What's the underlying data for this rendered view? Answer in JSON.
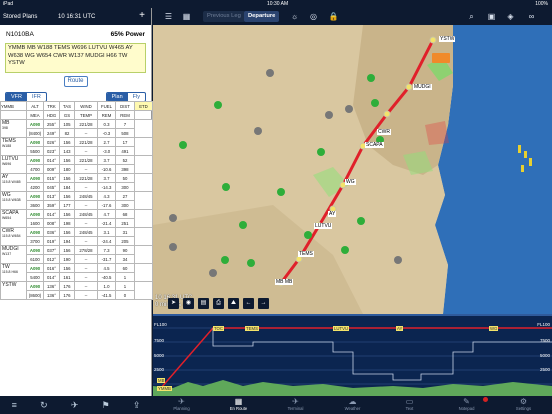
{
  "status": {
    "device": "iPad",
    "time": "10:30 AM",
    "battery": "100%"
  },
  "left": {
    "header": {
      "title": "Stored Plans",
      "datetime": "10 16:31 UTC",
      "add": "+"
    },
    "plan": {
      "reg": "N1010BA",
      "power": "65% Power",
      "route": "YMMB MB W188 TEMS W696 LUTVU W465 AY W638 WG W654 CWR W137 MUDGI H66 TW YSTW",
      "route_button": "Route",
      "rule_vfr": "VFR",
      "rule_ifr": "IFR",
      "mode_plan": "Plan",
      "mode_fly": "Fly"
    },
    "columns": [
      "YMMB",
      "ALT",
      "TRK",
      "TAS",
      "WIND",
      "FUEL",
      "DIST",
      "ETD"
    ],
    "subcolumns": [
      "",
      "MEA",
      "HDG",
      "GS",
      "TEMP",
      "REM",
      "REM",
      ""
    ],
    "rows": [
      {
        "wp": "MB",
        "sub": "398",
        "alt": "A090",
        "mea": "(8400)",
        "trk": "255°",
        "hdg": "249°",
        "tas": "105",
        "gs": "82",
        "wind": "221/28",
        "temp": "--",
        "fuel": "0.3",
        "frem": "-0.3",
        "dist": "7",
        "drem": "508"
      },
      {
        "wp": "TEMS",
        "sub": "W188",
        "alt": "A090",
        "mea": "5500",
        "trk": "026°",
        "hdg": "023°",
        "tas": "156",
        "gs": "143",
        "wind": "221/28",
        "temp": "--",
        "fuel": "2.7",
        "frem": "-3.0",
        "dist": "17",
        "drem": "491"
      },
      {
        "wp": "LUTVU",
        "sub": "W696",
        "alt": "A090",
        "mea": "4700",
        "trk": "014°",
        "hdg": "009°",
        "tas": "156",
        "gs": "180",
        "wind": "221/28",
        "temp": "--",
        "fuel": "3.7",
        "frem": "-10.6",
        "dist": "52",
        "drem": "398"
      },
      {
        "wp": "AY",
        "sub": "115.8 W465",
        "alt": "A090",
        "mea": "4200",
        "trk": "015°",
        "hdg": "045°",
        "tas": "156",
        "gs": "184",
        "wind": "221/28",
        "temp": "--",
        "fuel": "3.7",
        "frem": "-14.3",
        "dist": "50",
        "drem": "300"
      },
      {
        "wp": "WG",
        "sub": "115.8 W638",
        "alt": "A090",
        "mea": "3600",
        "trk": "013°",
        "hdg": "359°",
        "tas": "156",
        "gs": "177",
        "wind": "248/45",
        "temp": "--",
        "fuel": "4.3",
        "frem": "-17.6",
        "dist": "27",
        "drem": "300"
      },
      {
        "wp": "SCAPA",
        "sub": "W654",
        "alt": "A090",
        "mea": "1600",
        "trk": "014°",
        "hdg": "008°",
        "tas": "156",
        "gs": "198",
        "wind": "248/45",
        "temp": "--",
        "fuel": "4.7",
        "frem": "-21.4",
        "dist": "68",
        "drem": "251"
      },
      {
        "wp": "CWR",
        "sub": "115.8 W654",
        "alt": "A090",
        "mea": "3700",
        "trk": "036°",
        "hdg": "019°",
        "tas": "156",
        "gs": "194",
        "wind": "248/45",
        "temp": "--",
        "fuel": "3.1",
        "frem": "-24.4",
        "dist": "31",
        "drem": "205"
      },
      {
        "wp": "MUDGI",
        "sub": "W137",
        "alt": "A090",
        "mea": "6100",
        "trk": "037°",
        "hdg": "012°",
        "tas": "156",
        "gs": "190",
        "wind": "278/28",
        "temp": "--",
        "fuel": "7.3",
        "frem": "-31.7",
        "dist": "90",
        "drem": "34"
      },
      {
        "wp": "TW",
        "sub": "115.8 H66",
        "alt": "A090",
        "mea": "5400",
        "trk": "016°",
        "hdg": "014°",
        "tas": "156",
        "gs": "161",
        "wind": "--",
        "temp": "--",
        "fuel": "4.5",
        "frem": "-40.5",
        "dist": "60",
        "drem": "1"
      },
      {
        "wp": "YSTW",
        "sub": "",
        "alt": "A090",
        "mea": "(8600)",
        "trk": "136°",
        "hdg": "136°",
        "tas": "176",
        "gs": "176",
        "wind": "--",
        "temp": "--",
        "fuel": "1.0",
        "frem": "-41.5",
        "dist": "1",
        "drem": "0"
      }
    ]
  },
  "toolbar": {
    "prev_leg": "Previous Leg",
    "departure": "Departure"
  },
  "map": {
    "time_line1": "10 16:31 UTC",
    "time_line2": "0 minutes ago",
    "waypoints": [
      "YSTW",
      "MUDGI",
      "CWR",
      "SCAPA",
      "WG",
      "AY",
      "LUTVU",
      "TEMS",
      "MB MB"
    ]
  },
  "profile": {
    "levels": [
      "FL100",
      "7500",
      "5000",
      "2500"
    ],
    "right_levels": [
      "FL100",
      "7500",
      "5000",
      "2500"
    ],
    "wp_labels": [
      "TOC",
      "TEMS",
      "LUTVU",
      "AY",
      "WG"
    ],
    "start_labels": [
      "MB",
      "YMMB"
    ]
  },
  "nav": {
    "items": [
      "Planning",
      "En Route",
      "Terminal",
      "Weather",
      "Text",
      "Notepad",
      "Settings"
    ]
  },
  "colors": {
    "route": "#e0202a",
    "panel": "#0d1a30",
    "alt_green": "#2e8b2e",
    "etd_yellow": "#fff9b0"
  }
}
